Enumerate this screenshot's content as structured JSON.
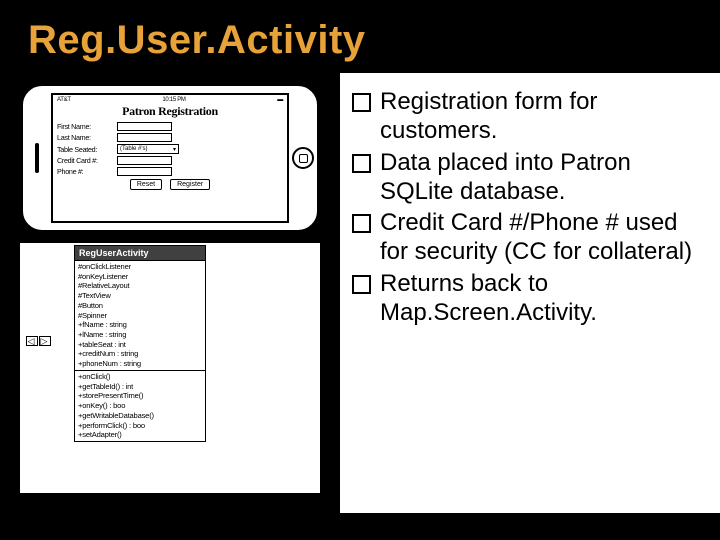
{
  "title": "Reg.User.Activity",
  "phone": {
    "status_left": "AT&T",
    "status_time": "10:15 PM",
    "form_title": "Patron Registration",
    "labels": {
      "first": "First Name:",
      "last": "Last Name:",
      "table": "Table Seated:",
      "cc": "Credit Card #:",
      "phone": "Phone #:"
    },
    "select_value": "(Table #'s)",
    "btn_reset": "Reset",
    "btn_register": "Register"
  },
  "uml": {
    "class_name": "RegUserActivity",
    "attrs": [
      "#onClickListener",
      "#onKeyListener",
      "#RelativeLayout",
      "#TextView",
      "#Button",
      "#Spinner",
      "+fName : string",
      "+lName : string",
      "+tableSeat : int",
      "+creditNum : string",
      "+phoneNum : string"
    ],
    "ops": [
      "+onClick()",
      "+getTableId() : int",
      "+storePresentTime()",
      "+onKey() : boo",
      "+getWritableDatabase()",
      "+performClick() : boo",
      "+setAdapter()"
    ]
  },
  "bullets": {
    "b1": "Registration form for customers.",
    "b2": "Data placed into Patron SQLite database.",
    "b3": "Credit Card #/Phone # used for security (CC for collateral)",
    "b4": "Returns back to Map.Screen.Activity."
  }
}
